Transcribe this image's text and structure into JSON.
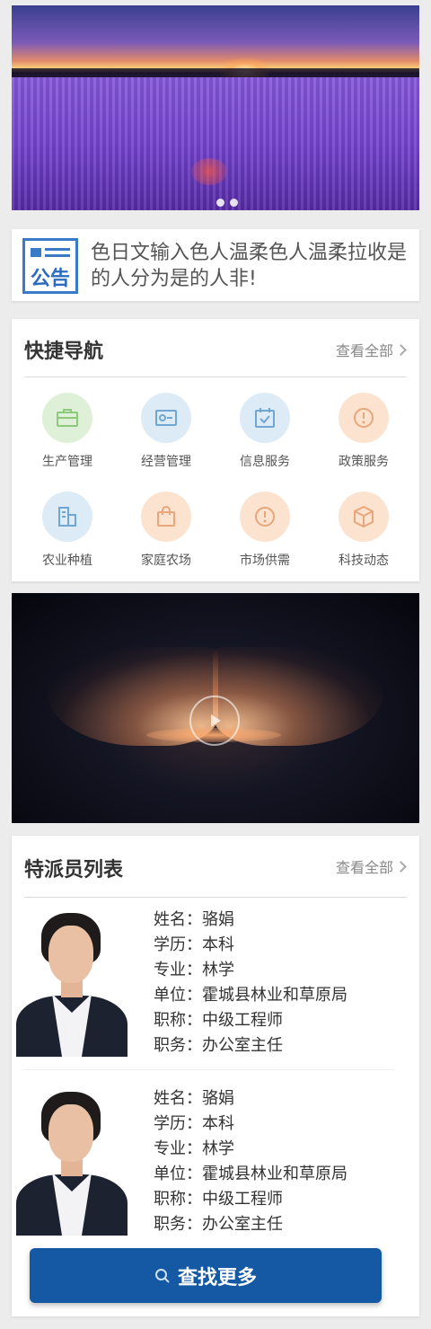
{
  "banner": {
    "active_dot": 1,
    "dot_count": 2
  },
  "notice": {
    "badge": "公告",
    "text": "色日文输入色人温柔色人温柔拉收是的人分为是的人非!"
  },
  "quick_nav": {
    "title": "快捷导航",
    "more": "查看全部",
    "items": [
      {
        "label": "生产管理",
        "icon": "briefcase-icon",
        "color": "green"
      },
      {
        "label": "经营管理",
        "icon": "id-card-icon",
        "color": "blue"
      },
      {
        "label": "信息服务",
        "icon": "calendar-check-icon",
        "color": "blue"
      },
      {
        "label": "政策服务",
        "icon": "alert-circle-icon",
        "color": "orange"
      },
      {
        "label": "农业种植",
        "icon": "building-icon",
        "color": "blue"
      },
      {
        "label": "家庭农场",
        "icon": "shopping-bag-icon",
        "color": "orange"
      },
      {
        "label": "市场供需",
        "icon": "alert-circle-icon",
        "color": "orange"
      },
      {
        "label": "科技动态",
        "icon": "cube-icon",
        "color": "orange"
      }
    ]
  },
  "video": {
    "icon": "play-icon"
  },
  "specialists": {
    "title": "特派员列表",
    "more": "查看全部",
    "people": [
      {
        "name": "姓名：骆娟",
        "education": "学历：本科",
        "major": "专业：林学",
        "unit": "单位：霍城县林业和草原局",
        "rank": "职称：中级工程师",
        "position": "职务：办公室主任"
      },
      {
        "name": "姓名：骆娟",
        "education": "学历：本科",
        "major": "专业：林学",
        "unit": "单位：霍城县林业和草原局",
        "rank": "职称：中级工程师",
        "position": "职务：办公室主任"
      }
    ]
  },
  "find_more": {
    "label": "查找更多",
    "icon": "search-icon"
  },
  "colors": {
    "primary": "#1559a5",
    "notice_blue": "#3a7bc8",
    "green_bg": "#dff0d8",
    "blue_bg": "#dcebf5",
    "orange_bg": "#fbe3cf"
  }
}
